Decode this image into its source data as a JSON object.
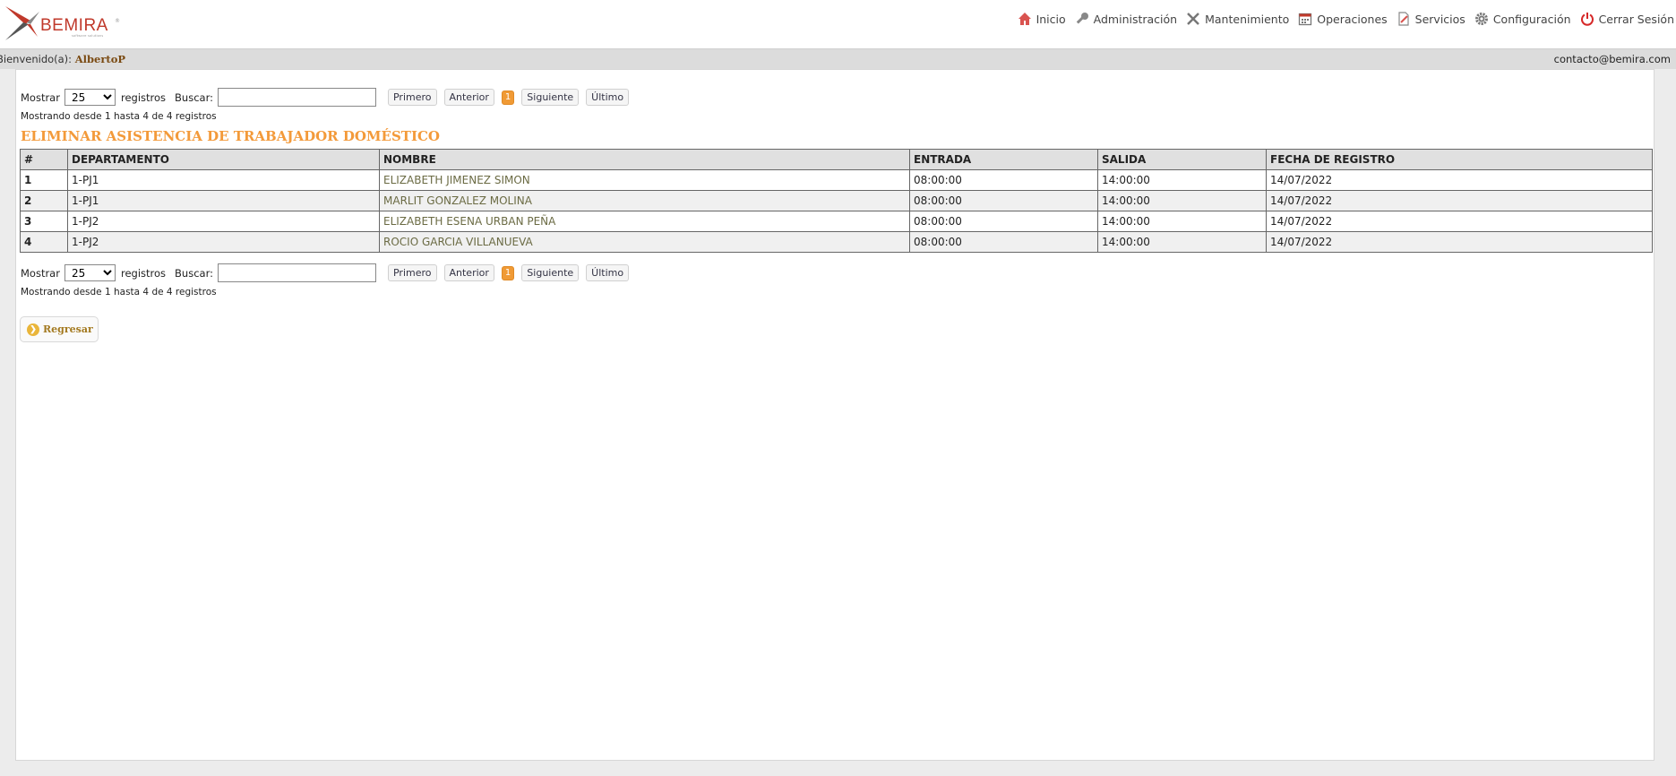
{
  "header": {
    "logo": {
      "word": "BEMIRA",
      "tagline": "software solutions",
      "registered": "®"
    },
    "nav": [
      {
        "label": "Inicio",
        "icon": "home-icon"
      },
      {
        "label": "Administración",
        "icon": "key-icon"
      },
      {
        "label": "Mantenimiento",
        "icon": "tools-icon"
      },
      {
        "label": "Operaciones",
        "icon": "calendar-icon"
      },
      {
        "label": "Servicios",
        "icon": "document-icon"
      },
      {
        "label": "Configuración",
        "icon": "gear-icon"
      },
      {
        "label": "Cerrar Sesión",
        "icon": "power-icon"
      }
    ]
  },
  "welcome": {
    "prefix": "Bienvenido(a):",
    "user": "AlbertoP",
    "contact": "contacto@bemira.com"
  },
  "controls": {
    "show_label": "Mostrar",
    "show_value": "25",
    "records_label": "registros",
    "search_label": "Buscar:",
    "search_value": "",
    "pager": {
      "first": "Primero",
      "prev": "Anterior",
      "current": "1",
      "next": "Siguiente",
      "last": "Último"
    },
    "info": "Mostrando desde 1 hasta 4 de 4 registros"
  },
  "title": "ELIMINAR ASISTENCIA DE TRABAJADOR DOMÉSTICO",
  "table": {
    "columns": [
      "#",
      "DEPARTAMENTO",
      "NOMBRE",
      "ENTRADA",
      "SALIDA",
      "FECHA DE REGISTRO"
    ],
    "rows": [
      [
        "1",
        "1-PJ1",
        "ELIZABETH JIMENEZ SIMON",
        "08:00:00",
        "14:00:00",
        "14/07/2022"
      ],
      [
        "2",
        "1-PJ1",
        "MARLIT GONZALEZ MOLINA",
        "08:00:00",
        "14:00:00",
        "14/07/2022"
      ],
      [
        "3",
        "1-PJ2",
        "ELIZABETH ESENA URBAN PEÑA",
        "08:00:00",
        "14:00:00",
        "14/07/2022"
      ],
      [
        "4",
        "1-PJ2",
        "ROCIO GARCIA VILLANUEVA",
        "08:00:00",
        "14:00:00",
        "14/07/2022"
      ]
    ]
  },
  "back_button": {
    "label": "Regresar",
    "icon": "arrow-circle-icon"
  },
  "colors": {
    "accent": "#f39a3a",
    "brand": "#c0392b",
    "user": "#7a4a12",
    "link": "#6b6b44"
  }
}
